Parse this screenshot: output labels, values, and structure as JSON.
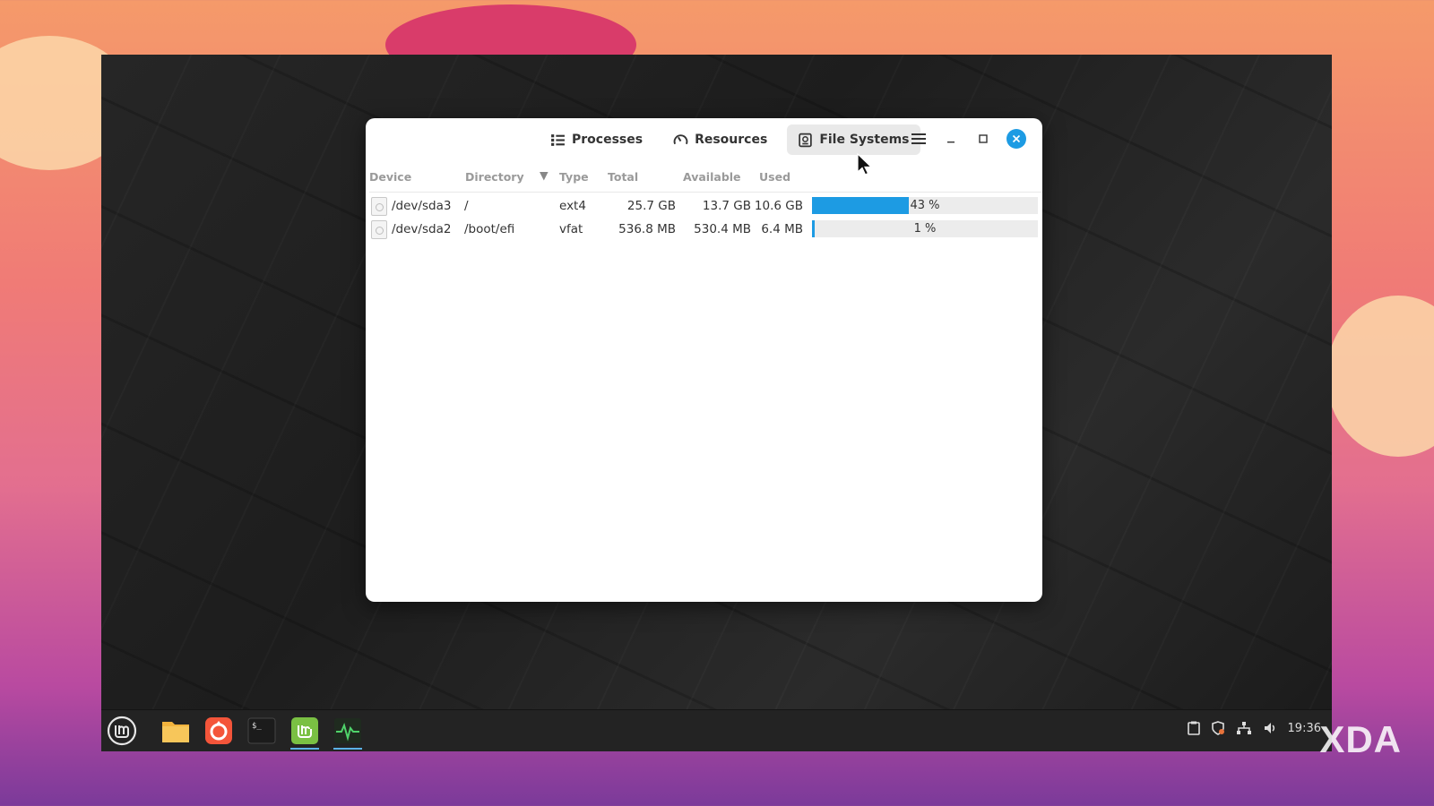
{
  "app": {
    "tabs": [
      {
        "label": "Processes",
        "icon": "list-icon"
      },
      {
        "label": "Resources",
        "icon": "gauge-icon"
      },
      {
        "label": "File Systems",
        "icon": "drive-icon",
        "active": true
      }
    ]
  },
  "filesystems": {
    "columns": {
      "device": "Device",
      "directory": "Directory",
      "type": "Type",
      "total": "Total",
      "available": "Available",
      "used": "Used"
    },
    "rows": [
      {
        "device": "/dev/sda3",
        "directory": "/",
        "type": "ext4",
        "total": "25.7 GB",
        "available": "13.7 GB",
        "used": "10.6 GB",
        "percent": 43,
        "percent_label": "43 %"
      },
      {
        "device": "/dev/sda2",
        "directory": "/boot/efi",
        "type": "vfat",
        "total": "536.8 MB",
        "available": "530.4 MB",
        "used": "6.4 MB",
        "percent": 1,
        "percent_label": "1 %"
      }
    ]
  },
  "panel": {
    "clock": "19:36",
    "launchers": [
      "mint-menu-icon",
      "files-icon",
      "firefox-icon",
      "terminal-icon",
      "mintinstall-icon",
      "system-monitor-icon"
    ],
    "tray": [
      "clipboard-icon",
      "shield-icon",
      "network-icon",
      "volume-icon"
    ]
  },
  "watermark": "XDA",
  "colors": {
    "accent": "#1d9be3",
    "panel": "#232323"
  }
}
